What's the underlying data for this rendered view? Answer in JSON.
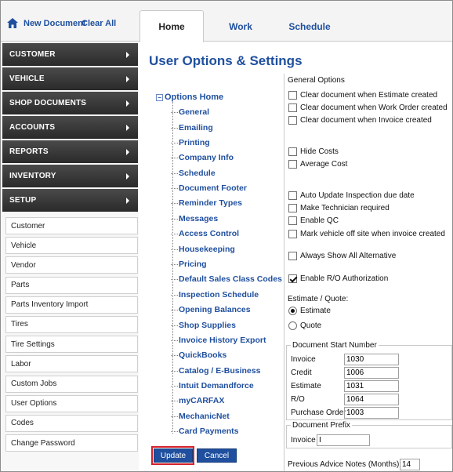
{
  "top": {
    "new_document": "New Document",
    "clear_all": "Clear All",
    "tabs": [
      "Home",
      "Work",
      "Schedule"
    ],
    "active_tab": "Home"
  },
  "sidebar": {
    "sections": [
      "CUSTOMER",
      "VEHICLE",
      "SHOP DOCUMENTS",
      "ACCOUNTS",
      "REPORTS",
      "INVENTORY",
      "SETUP"
    ],
    "setup_items": [
      "Customer",
      "Vehicle",
      "Vendor",
      "Parts",
      "Parts Inventory Import",
      "Tires",
      "Tire Settings",
      "Labor",
      "Custom Jobs",
      "User Options",
      "Codes",
      "Change Password"
    ]
  },
  "main": {
    "title": "User Options & Settings",
    "tree_root": "Options Home",
    "tree_items": [
      "General",
      "Emailing",
      "Printing",
      "Company Info",
      "Schedule",
      "Document Footer",
      "Reminder Types",
      "Messages",
      "Access Control",
      "Housekeeping",
      "Pricing",
      "Default Sales Class Codes",
      "Inspection Schedule",
      "Opening Balances",
      "Shop Supplies",
      "Invoice History Export",
      "QuickBooks",
      "Catalog / E-Business",
      "Intuit Demandforce",
      "myCARFAX",
      "MechanicNet",
      "Card Payments"
    ],
    "update_label": "Update",
    "cancel_label": "Cancel"
  },
  "options": {
    "general_title": "General Options",
    "checkboxes": [
      {
        "label": "Clear document when Estimate created",
        "checked": false
      },
      {
        "label": "Clear document when Work Order created",
        "checked": false
      },
      {
        "label": "Clear document when Invoice created",
        "checked": false
      },
      {
        "label": "Hide Costs",
        "checked": false
      },
      {
        "label": "Average Cost",
        "checked": false
      },
      {
        "label": "Auto Update Inspection due date",
        "checked": false
      },
      {
        "label": "Make Technician required",
        "checked": false
      },
      {
        "label": "Enable QC",
        "checked": false
      },
      {
        "label": "Mark vehicle off site when invoice created",
        "checked": false
      },
      {
        "label": "Always Show All Alternative",
        "checked": false
      },
      {
        "label": "Enable R/O Authorization",
        "checked": true
      }
    ],
    "estimate_quote_title": "Estimate / Quote:",
    "estimate_label": "Estimate",
    "quote_label": "Quote",
    "selected": "Estimate",
    "doc_start_title": "Document Start Number",
    "doc_numbers": [
      {
        "label": "Invoice",
        "value": "1030"
      },
      {
        "label": "Credit",
        "value": "1006"
      },
      {
        "label": "Estimate",
        "value": "1031"
      },
      {
        "label": "R/O",
        "value": "1064"
      },
      {
        "label": "Purchase Order",
        "value": "1003"
      }
    ],
    "doc_prefix_title": "Document Prefix",
    "prefix_label": "Invoice",
    "prefix_value": "I",
    "advice_label": "Previous Advice Notes (Months):",
    "advice_value": "14"
  }
}
